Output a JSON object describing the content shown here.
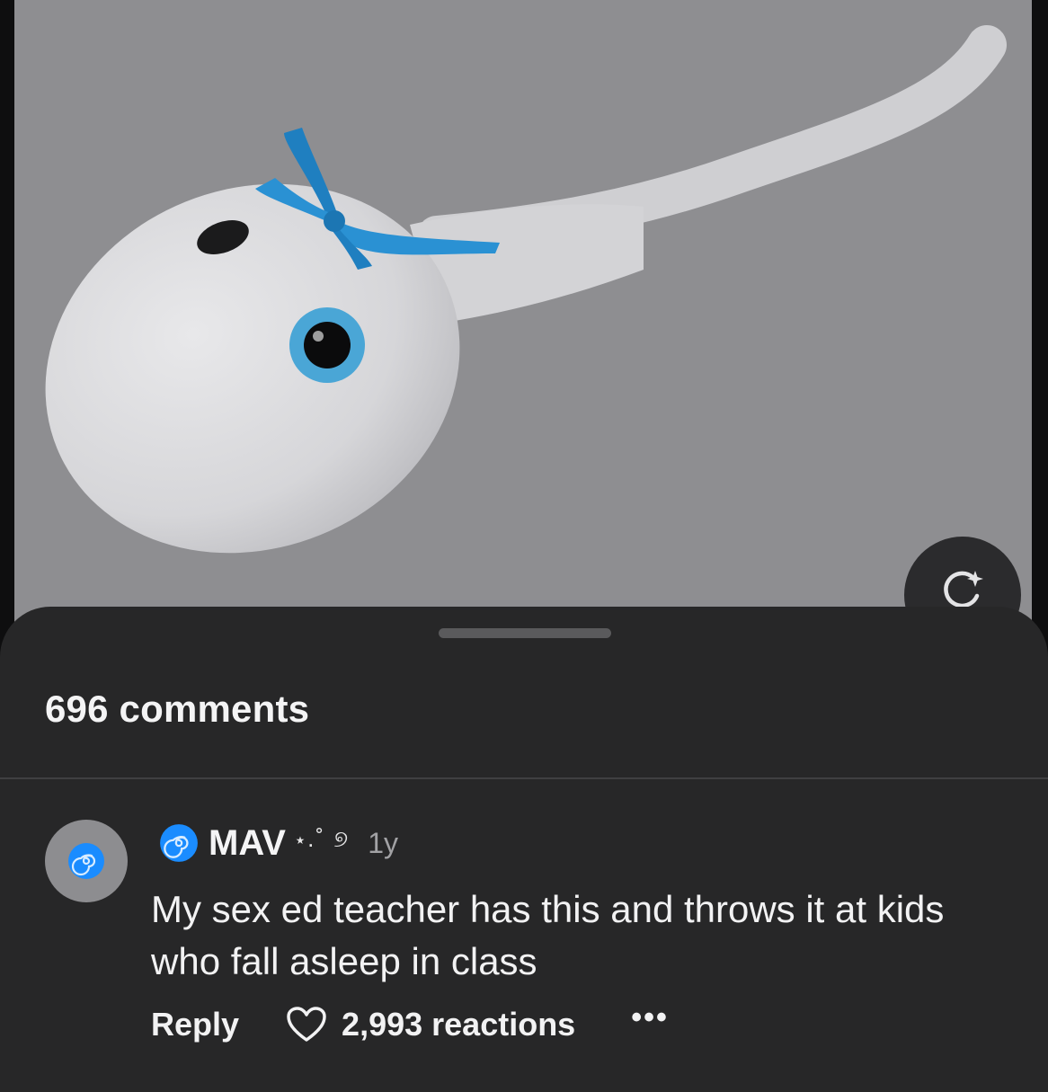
{
  "post": {
    "image_alt": "plush toy"
  },
  "ai_button": {
    "icon": "sparkle-refresh-icon"
  },
  "comments": {
    "count_label": "696 comments",
    "items": [
      {
        "avatar_icon": "spiral-icon",
        "username": "MAV",
        "username_icon": "spiral-icon",
        "decoration": "⋆.˚ ୭",
        "time": "1y",
        "text": "My sex ed teacher has this and throws it at kids who fall asleep in class",
        "reply_label": "Reply",
        "reactions_label": "2,993 reactions",
        "more_label": "•••"
      }
    ]
  },
  "colors": {
    "sheet_bg": "#272728",
    "photo_bg": "#8e8e91",
    "text_primary": "#f4f4f5",
    "text_secondary": "#a2a2a5",
    "spiral_blue": "#1a8cff"
  }
}
